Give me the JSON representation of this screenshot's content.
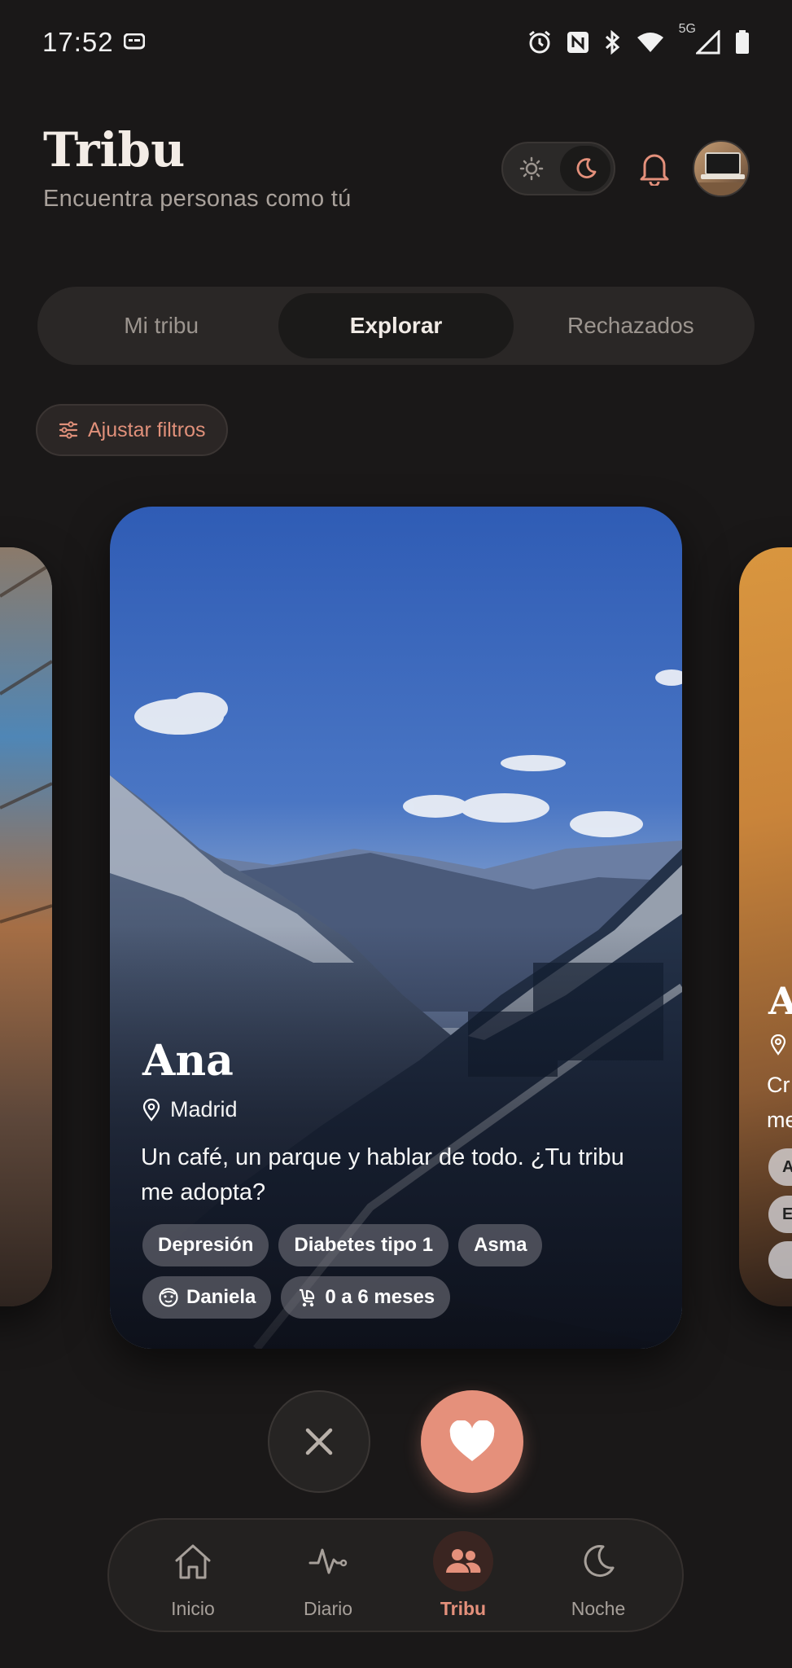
{
  "status_bar": {
    "time": "17:52",
    "network_label": "5G",
    "icons": [
      "message-icon",
      "alarm-icon",
      "nfc-icon",
      "bluetooth-icon",
      "wifi-icon",
      "signal-icon",
      "battery-icon"
    ]
  },
  "header": {
    "title": "Tribu",
    "subtitle": "Encuentra personas como tú",
    "theme_options": [
      "sun-icon",
      "moon-icon"
    ],
    "active_theme": "dark"
  },
  "tabs": [
    {
      "label": "Mi tribu",
      "active": false
    },
    {
      "label": "Explorar",
      "active": true
    },
    {
      "label": "Rechazados",
      "active": false
    }
  ],
  "filter": {
    "label": "Ajustar filtros"
  },
  "profile_card": {
    "name": "Ana",
    "location": "Madrid",
    "bio": "Un café, un parque y hablar de todo. ¿Tu tribu me adopta?",
    "condition_tags": [
      "Depresión",
      "Diabetes tipo 1",
      "Asma"
    ],
    "child_name": "Daniela",
    "child_age": "0 a 6 meses"
  },
  "next_card_preview": {
    "name_initial": "A",
    "bio_fragment_1": "Cr",
    "bio_fragment_2": "me",
    "chip_1": "A",
    "chip_2": "E"
  },
  "bottom_nav": [
    {
      "label": "Inicio",
      "icon": "home-icon",
      "active": false
    },
    {
      "label": "Diario",
      "icon": "pulse-icon",
      "active": false
    },
    {
      "label": "Tribu",
      "icon": "people-icon",
      "active": true
    },
    {
      "label": "Noche",
      "icon": "moon-icon",
      "active": false
    }
  ],
  "colors": {
    "accent": "#e5907b",
    "background": "#1a1818"
  }
}
